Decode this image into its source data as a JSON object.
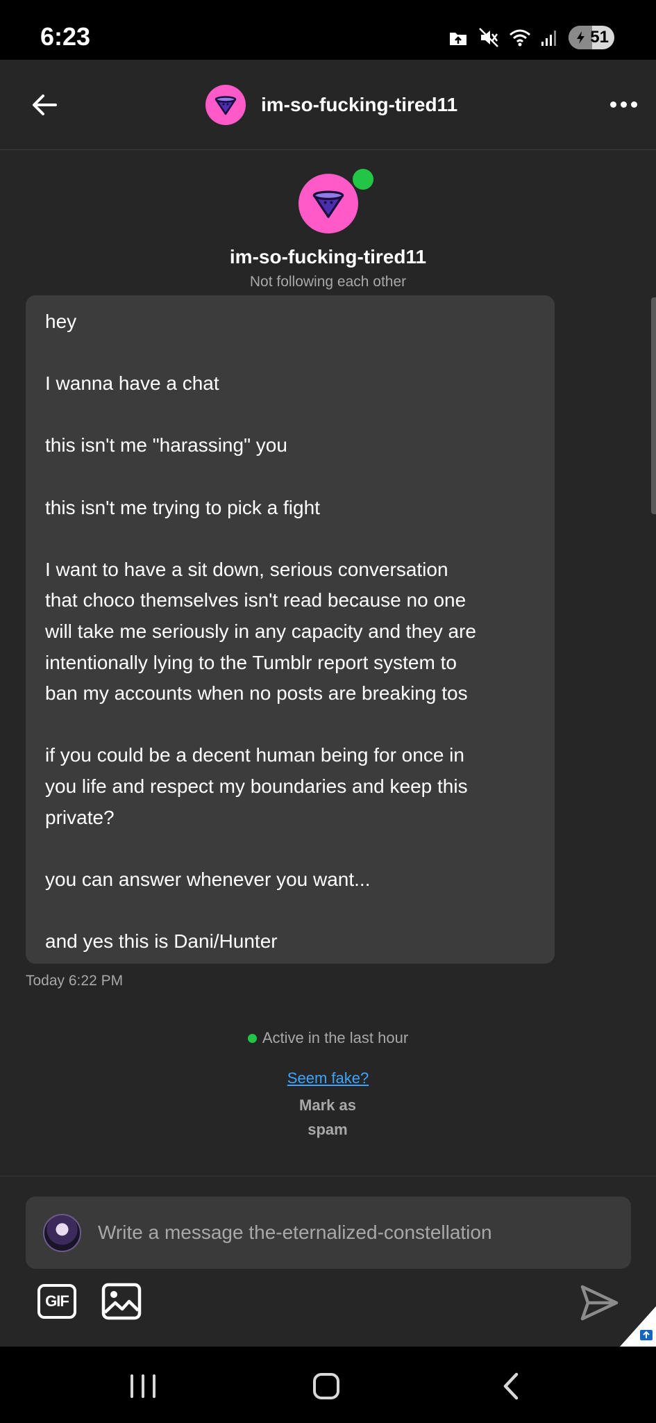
{
  "status_bar": {
    "time": "6:23",
    "battery": "51",
    "icons": [
      "upload-icon",
      "mute-icon",
      "wifi-icon",
      "signal-icon",
      "battery-icon"
    ]
  },
  "header": {
    "username": "im-so-fucking-tired11",
    "back_icon": "arrow-left-icon",
    "more_icon": "more-horizontal-icon"
  },
  "profile": {
    "username": "im-so-fucking-tired11",
    "relationship": "Not following each other"
  },
  "message": {
    "lines": [
      "hey",
      "",
      "I wanna have a chat",
      "",
      "this isn't me \"harassing\" you",
      "",
      "this isn't me trying to pick a fight",
      "",
      "I want to have a sit down, serious conversation",
      "that choco themselves isn't read because no one",
      "will take me seriously in any capacity and they are",
      "intentionally lying to the Tumblr report system to",
      "ban my accounts when no posts are breaking tos",
      "",
      "if you could be a decent human being for once in",
      "you life and respect my boundaries and keep this",
      "private?",
      "",
      "you can answer whenever you want...",
      "",
      "and yes this is Dani/Hunter"
    ],
    "timestamp": "Today 6:22 PM"
  },
  "activity": {
    "status": "Active in the last hour",
    "seem_fake": "Seem fake?",
    "mark_as": "Mark as",
    "spam": "spam"
  },
  "composer": {
    "placeholder": "Write a message the-eternalized-constellation",
    "gif_label": "GIF"
  },
  "colors": {
    "background": "#262626",
    "bubble": "#3c3c3c",
    "avatar_pink": "#ff5ac8",
    "online_green": "#22c545",
    "link_blue": "#3da5ff"
  }
}
